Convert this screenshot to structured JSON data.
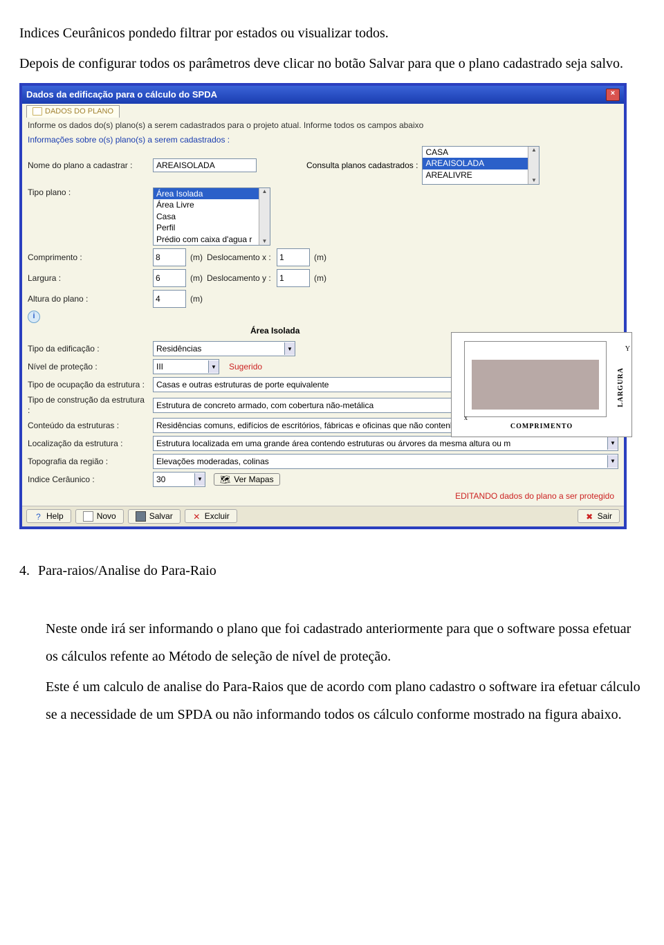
{
  "para1": "Indices Ceurânicos pondedo filtrar por estados ou visualizar todos.",
  "para2": "Depois de configurar todos os parâmetros deve clicar no botão Salvar para que o plano cadastrado seja salvo.",
  "dialog": {
    "title": "Dados da edificação para o cálculo do SPDA",
    "tab": "DADOS DO PLANO",
    "instruction": "Informe os dados do(s) plano(s) a serem cadastrados para o projeto atual. Informe todos os campos abaixo",
    "group_header": "Informações sobre o(s) plano(s) a serem cadastrados :",
    "labels": {
      "nome": "Nome do plano a cadastrar :",
      "tipo": "Tipo plano :",
      "consulta": "Consulta planos cadastrados :",
      "comprimento": "Comprimento :",
      "largura": "Largura :",
      "altura": "Altura do plano :",
      "desloc_x": "Deslocamento x :",
      "desloc_y": "Deslocamento y :",
      "area_label": "Área Isolada",
      "tipo_edif": "Tipo da edificação :",
      "nivel": "Nível de proteção :",
      "sugerido": "Sugerido",
      "tipo_ocup": "Tipo de ocupação da estrutura :",
      "tipo_constr": "Tipo de construção da estrutura :",
      "conteudo": "Conteúdo da estruturas :",
      "localizacao": "Localização da estrutura :",
      "topografia": "Topografia da região :",
      "indice": "Indice Cerâunico :",
      "ver_mapas": "Ver Mapas",
      "editando": "EDITANDO dados do plano a ser protegido",
      "unidade": "(m)"
    },
    "values": {
      "nome": "AREAISOLADA",
      "tipo_opts": [
        "Área Isolada",
        "Área Livre",
        "Casa",
        "Perfil",
        "Prédio com caixa d'agua r"
      ],
      "consulta_opts": [
        "CASA",
        "AREAISOLADA",
        "AREALIVRE"
      ],
      "comprimento": "8",
      "largura": "6",
      "altura": "4",
      "desloc_x": "1",
      "desloc_y": "1",
      "tipo_edif": "Residências",
      "nivel": "III",
      "tipo_ocup": "Casas e outras estruturas de porte equivalente",
      "tipo_constr": "Estrutura de concreto armado, com cobertura não-metálica",
      "conteudo": "Residências comuns, edifícios de escritórios, fábricas e oficinas que não contenham objetos de",
      "localizacao": "Estrutura localizada em uma grande área contendo estruturas ou árvores da mesma altura ou m",
      "topografia": "Elevações moderadas, colinas",
      "indice": "30"
    },
    "diagram": {
      "largura": "LARGURA",
      "comprimento": "COMPRIMENTO",
      "x": "x",
      "y": "Y"
    },
    "buttons": {
      "help": "Help",
      "novo": "Novo",
      "salvar": "Salvar",
      "excluir": "Excluir",
      "sair": "Sair"
    }
  },
  "section4": {
    "num": "4.",
    "title": "Para-raios/Analise do Para-Raio",
    "p1a": "Neste onde irá ser informando o plano que foi cadastrado anteriormente para que o software possa efetuar os cálculos refente ao Método de seleção de nível de proteção.",
    "p1b": "Este é um calculo de analise do Para-Raios que de acordo com plano cadastro o software ira efetuar cálculo se a necessidade de um SPDA ou não informando todos os cálculo conforme mostrado na figura abaixo."
  }
}
